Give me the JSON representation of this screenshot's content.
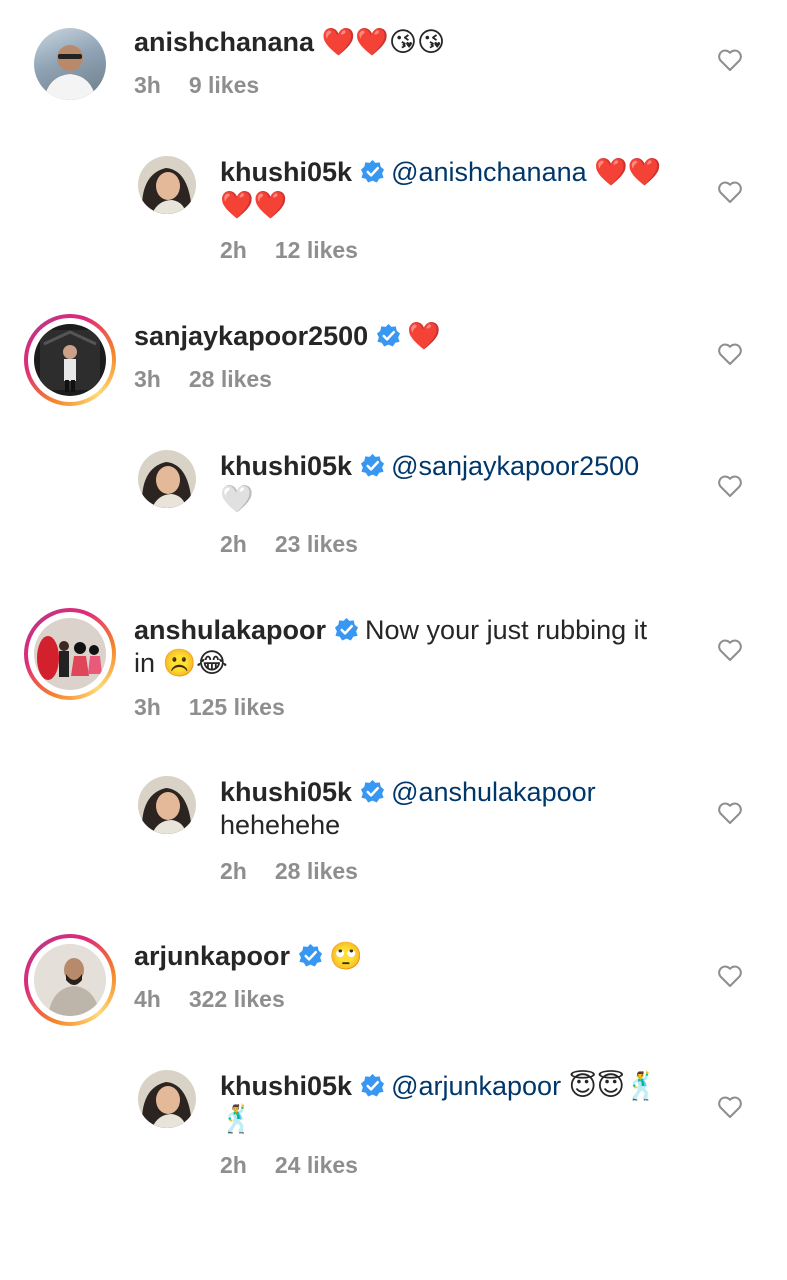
{
  "comments": [
    {
      "username": "anishchanana",
      "text": "",
      "emojis": "❤️❤️😘😘",
      "time": "3h",
      "likes": "9 likes",
      "verified": false,
      "reply": {
        "username": "khushi05k",
        "mention": "@anishchanana",
        "text": "",
        "emojis_line1": "❤️❤️",
        "emojis_line2": "❤️❤️",
        "time": "2h",
        "likes": "12 likes"
      }
    },
    {
      "username": "sanjaykapoor2500",
      "text": "",
      "emojis": "❤️",
      "time": "3h",
      "likes": "28 likes",
      "verified": true,
      "reply": {
        "username": "khushi05k",
        "mention": "@sanjaykapoor2500",
        "emojis_line2": "🤍",
        "time": "2h",
        "likes": "23 likes"
      }
    },
    {
      "username": "anshulakapoor",
      "text_line1": "Now your just rubbing it",
      "text_line2": "in",
      "emojis": "☹️😂",
      "time": "3h",
      "likes": "125 likes",
      "verified": true,
      "reply": {
        "username": "khushi05k",
        "mention": "@anshulakapoor",
        "text_line2": "hehehehe",
        "time": "2h",
        "likes": "28 likes"
      }
    },
    {
      "username": "arjunkapoor",
      "emojis": "🙄",
      "time": "4h",
      "likes": "322 likes",
      "verified": true,
      "reply": {
        "username": "khushi05k",
        "mention": "@arjunkapoor",
        "emojis_line1": "😇😇🕺",
        "emojis_line2": "🕺",
        "time": "2h",
        "likes": "24 likes"
      }
    }
  ],
  "colors": {
    "username": "#262626",
    "mention": "#00376b",
    "meta": "#8e8e8e",
    "verified": "#3897f0"
  },
  "icons": {
    "like": "heart-outline-icon",
    "verified": "verified-badge-icon"
  }
}
